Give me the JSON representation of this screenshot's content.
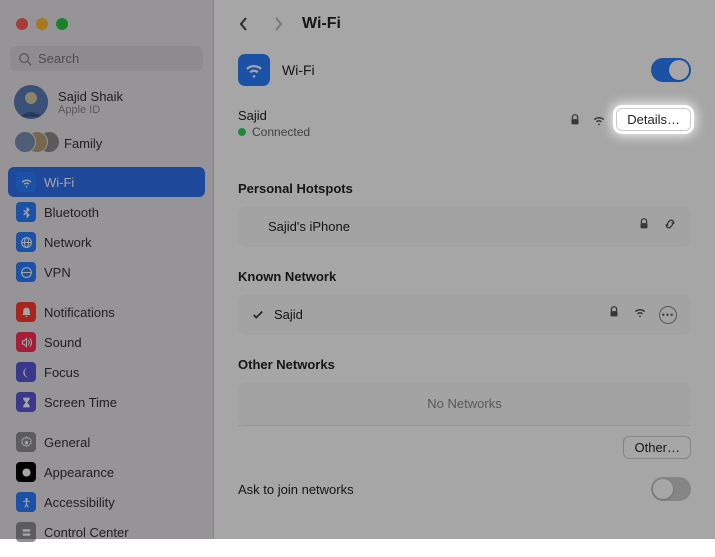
{
  "search": {
    "placeholder": "Search"
  },
  "user": {
    "name": "Sajid Shaik",
    "sub": "Apple ID"
  },
  "family": {
    "label": "Family"
  },
  "sidebar": {
    "group1": [
      {
        "label": "Wi-Fi"
      },
      {
        "label": "Bluetooth"
      },
      {
        "label": "Network"
      },
      {
        "label": "VPN"
      }
    ],
    "group2": [
      {
        "label": "Notifications"
      },
      {
        "label": "Sound"
      },
      {
        "label": "Focus"
      },
      {
        "label": "Screen Time"
      }
    ],
    "group3": [
      {
        "label": "General"
      },
      {
        "label": "Appearance"
      },
      {
        "label": "Accessibility"
      },
      {
        "label": "Control Center"
      }
    ]
  },
  "header": {
    "title": "Wi-Fi"
  },
  "wifi": {
    "title": "Wi-Fi",
    "current": {
      "name": "Sajid",
      "status": "Connected",
      "details_btn": "Details…"
    }
  },
  "sections": {
    "personal_hotspots": {
      "title": "Personal Hotspots",
      "items": [
        {
          "label": "Sajid's iPhone"
        }
      ]
    },
    "known": {
      "title": "Known Network",
      "items": [
        {
          "label": "Sajid"
        }
      ]
    },
    "other": {
      "title": "Other Networks",
      "empty": "No Networks",
      "other_btn": "Other…"
    }
  },
  "ask_join": {
    "label": "Ask to join networks"
  }
}
